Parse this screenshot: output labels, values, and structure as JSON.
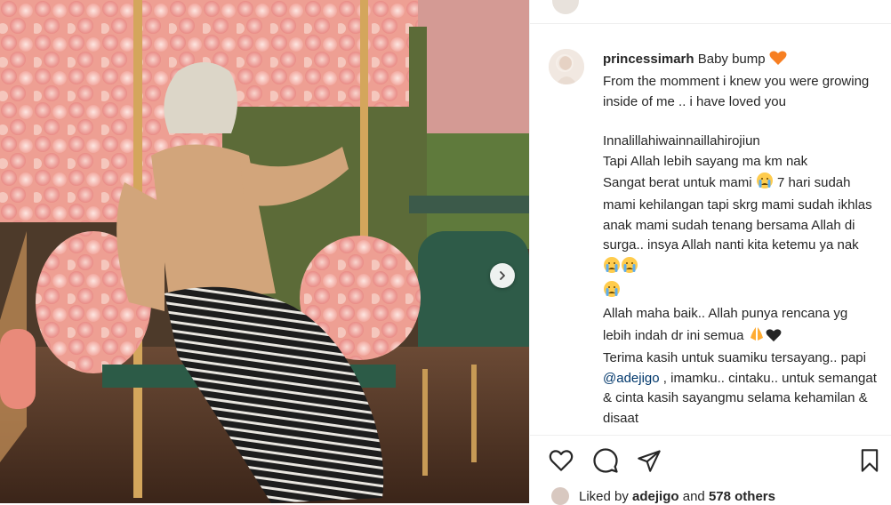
{
  "post": {
    "username": "princessimarh",
    "caption_head": "Baby bump",
    "caption_line1": "From the momment i knew you were growing inside of me .. i have loved you",
    "caption_line2": "Innalillahiwainnaillahirojiun",
    "caption_line3a": "Tapi Allah lebih sayang ma km nak",
    "caption_line3b": "Sangat berat untuk mami",
    "caption_line3c": "7 hari sudah mami kehilangan tapi skrg mami sudah ikhlas anak mami sudah tenang bersama Allah di surga.. insya Allah nanti kita ketemu ya nak",
    "caption_line4": "Allah maha baik.. Allah punya rencana yg lebih indah dr ini semua",
    "caption_line5a": "Terima kasih untuk suamiku tersayang.. papi",
    "caption_mention": "@adejigo",
    "caption_line5b": ", imamku.. cintaku.. untuk semangat & cinta kasih sayangmu selama kehamilan & disaat"
  },
  "likes": {
    "prefix": "Liked by",
    "user": "adejigo",
    "middle": "and",
    "others": "578 others"
  },
  "icons": {
    "heart": "heart-icon",
    "comment": "comment-icon",
    "share": "paper-plane-icon",
    "save": "bookmark-icon",
    "next": "chevron-right-icon"
  },
  "colors": {
    "text": "#262626",
    "mention": "#00376b",
    "divider": "#efefef",
    "orange_heart": "#f77f22"
  }
}
